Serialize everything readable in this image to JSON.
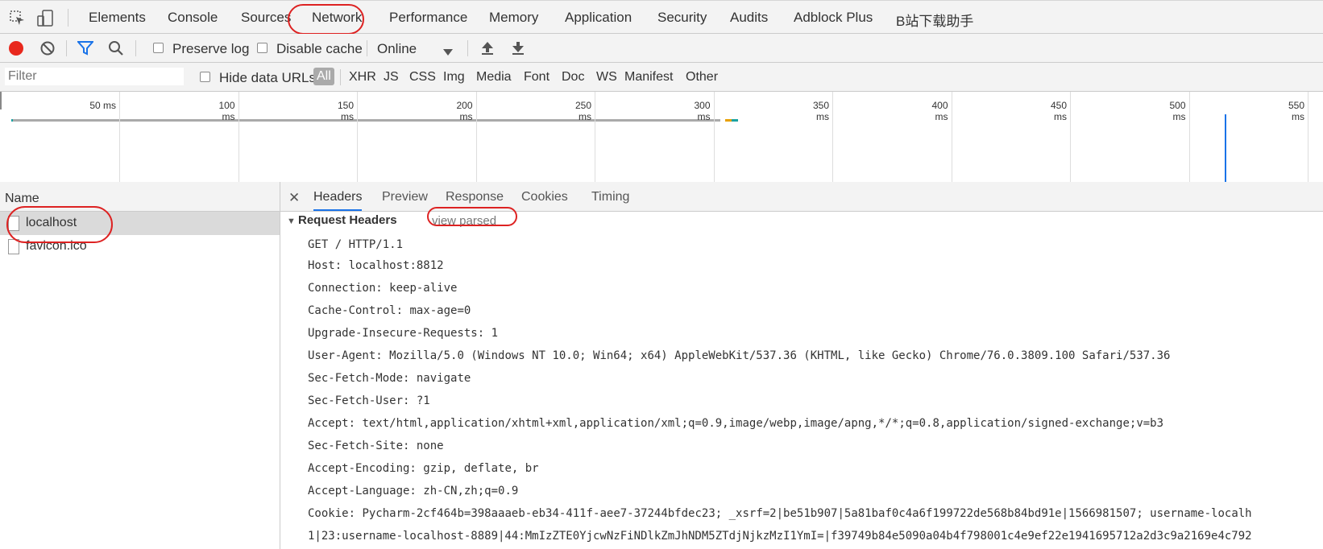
{
  "tabs": [
    "Elements",
    "Console",
    "Sources",
    "Network",
    "Performance",
    "Memory",
    "Application",
    "Security",
    "Audits",
    "Adblock Plus",
    "B站下载助手"
  ],
  "toolbar": {
    "preserve_log": "Preserve log",
    "disable_cache": "Disable cache",
    "throttle": "Online"
  },
  "filterbar": {
    "placeholder": "Filter",
    "hide_data_urls": "Hide data URLs",
    "types": [
      "All",
      "XHR",
      "JS",
      "CSS",
      "Img",
      "Media",
      "Font",
      "Doc",
      "WS",
      "Manifest",
      "Other"
    ]
  },
  "timeline": {
    "ticks": [
      "50 ms",
      "100 ms",
      "150 ms",
      "200 ms",
      "250 ms",
      "300 ms",
      "350 ms",
      "400 ms",
      "450 ms",
      "500 ms",
      "550 ms"
    ]
  },
  "requests": {
    "column_name": "Name",
    "items": [
      "localhost",
      "favicon.ico"
    ]
  },
  "detail": {
    "tabs": [
      "Headers",
      "Preview",
      "Response",
      "Cookies",
      "Timing"
    ],
    "section_title": "Request Headers",
    "view_parsed": "view parsed",
    "request_line": "GET / HTTP/1.1",
    "headers": [
      {
        "key": "Host:",
        "value": "localhost:8812"
      },
      {
        "key": "Connection:",
        "value": "keep-alive"
      },
      {
        "key": "Cache-Control:",
        "value": "max-age=0"
      },
      {
        "key": "Upgrade-Insecure-Requests:",
        "value": "1"
      },
      {
        "key": "User-Agent:",
        "value": "Mozilla/5.0 (Windows NT 10.0; Win64; x64) AppleWebKit/537.36 (KHTML, like Gecko) Chrome/76.0.3809.100 Safari/537.36"
      },
      {
        "key": "Sec-Fetch-Mode:",
        "value": "navigate"
      },
      {
        "key": "Sec-Fetch-User:",
        "value": "?1"
      },
      {
        "key": "Accept:",
        "value": "text/html,application/xhtml+xml,application/xml;q=0.9,image/webp,image/apng,*/*;q=0.8,application/signed-exchange;v=b3"
      },
      {
        "key": "Sec-Fetch-Site:",
        "value": "none"
      },
      {
        "key": "Accept-Encoding:",
        "value": "gzip, deflate, br"
      },
      {
        "key": "Accept-Language:",
        "value": "zh-CN,zh;q=0.9"
      },
      {
        "key": "Cookie:",
        "value": "Pycharm-2cf464b=398aaaeb-eb34-411f-aee7-37244bfdec23; _xsrf=2|be51b907|5a81baf0c4a6f199722de568b84bd91e|1566981507; username-localh"
      }
    ],
    "cookie_continuation": "1|23:username-localhost-8889|44:MmIzZTE0YjcwNzFiNDlkZmJhNDM5ZTdjNjkzMzI1YmI=|f39749b84e5090a04b4f798001c4e9ef22e1941695712a2d3c9a2169e4c792"
  },
  "colors": {
    "record": "#e8281d",
    "accent_blue": "#1a73e8",
    "annotation": "#d22222"
  }
}
